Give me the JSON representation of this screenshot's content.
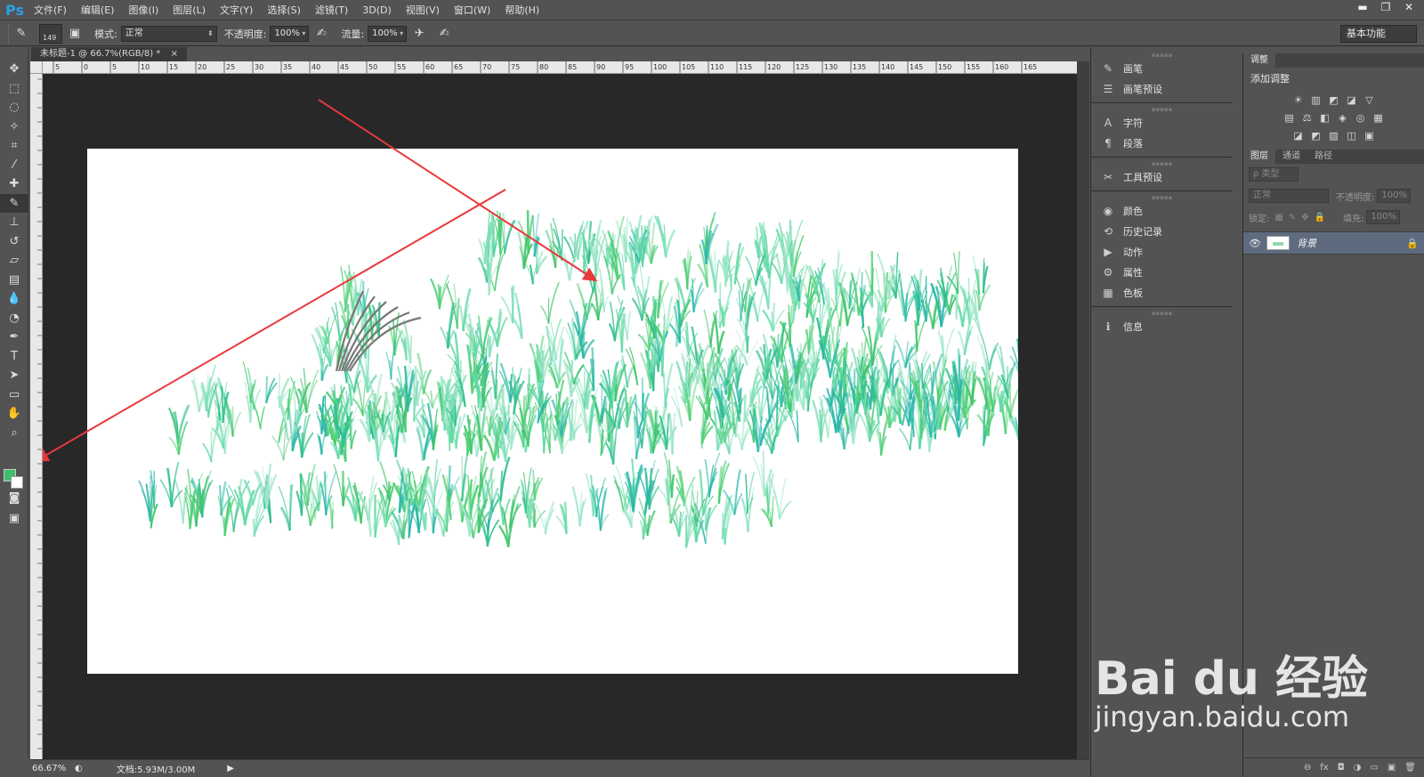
{
  "app": {
    "logo": "Ps"
  },
  "menu": [
    "文件(F)",
    "编辑(E)",
    "图像(I)",
    "图层(L)",
    "文字(Y)",
    "选择(S)",
    "滤镜(T)",
    "3D(D)",
    "视图(V)",
    "窗口(W)",
    "帮助(H)"
  ],
  "window_controls": [
    "▬",
    "❐",
    "✕"
  ],
  "options": {
    "brush_size": "149",
    "mode_label": "模式:",
    "mode_value": "正常",
    "opacity_label": "不透明度:",
    "opacity_value": "100%",
    "flow_label": "流量:",
    "flow_value": "100%",
    "workspace": "基本功能"
  },
  "document": {
    "tab_title": "未标题-1 @ 66.7%(RGB/8) *",
    "zoom": "66.67%",
    "doc_size": "文档:5.93M/3.00M"
  },
  "ruler_top_labels": [
    "5",
    "0",
    "5",
    "10",
    "15",
    "20",
    "25",
    "30",
    "35",
    "40",
    "45",
    "50",
    "55",
    "60",
    "65",
    "70",
    "75",
    "80",
    "85",
    "90",
    "95",
    "100",
    "105",
    "110",
    "115",
    "120",
    "125",
    "130",
    "135",
    "140",
    "145",
    "150",
    "155",
    "160",
    "165"
  ],
  "dock": [
    {
      "icon": "brush-icon",
      "glyph": "✎",
      "label": "画笔"
    },
    {
      "icon": "brush-preset-icon",
      "glyph": "☰",
      "label": "画笔预设"
    },
    {
      "icon": "character-icon",
      "glyph": "A",
      "label": "字符"
    },
    {
      "icon": "paragraph-icon",
      "glyph": "¶",
      "label": "段落"
    },
    {
      "icon": "tool-preset-icon",
      "glyph": "✂",
      "label": "工具预设"
    },
    {
      "icon": "color-icon",
      "glyph": "◉",
      "label": "颜色"
    },
    {
      "icon": "history-icon",
      "glyph": "⟲",
      "label": "历史记录"
    },
    {
      "icon": "actions-icon",
      "glyph": "▶",
      "label": "动作"
    },
    {
      "icon": "properties-icon",
      "glyph": "⚙",
      "label": "属性"
    },
    {
      "icon": "swatches-icon",
      "glyph": "▦",
      "label": "色板"
    },
    {
      "icon": "info-icon",
      "glyph": "ℹ",
      "label": "信息"
    }
  ],
  "adjustments": {
    "tab": "调整",
    "title": "添加调整",
    "row1": [
      "☀",
      "▥",
      "◩",
      "◪",
      "▽"
    ],
    "row2": [
      "▤",
      "⚖",
      "◧",
      "◈",
      "◎",
      "▦"
    ],
    "row3": [
      "◪",
      "◩",
      "▨",
      "◫",
      "▣"
    ]
  },
  "layers": {
    "tabs": [
      "图层",
      "通道",
      "路径"
    ],
    "filter_label": "ρ 类型",
    "blend": "正常",
    "opacity_label": "不透明度:",
    "opacity_value": "100%",
    "lock_label": "锁定:",
    "fill_label": "填充:",
    "fill_value": "100%",
    "layer_name": "背景"
  },
  "footer_icons": [
    "⊖",
    "fx",
    "◘",
    "◑",
    "▭",
    "▣",
    "🗑"
  ],
  "colors": {
    "foreground": "#3fbe6c",
    "background": "#ffffff",
    "arrow": "#e8383a"
  },
  "watermark": {
    "brand": "Bai du 经验",
    "url": "jingyan.baidu.com"
  }
}
